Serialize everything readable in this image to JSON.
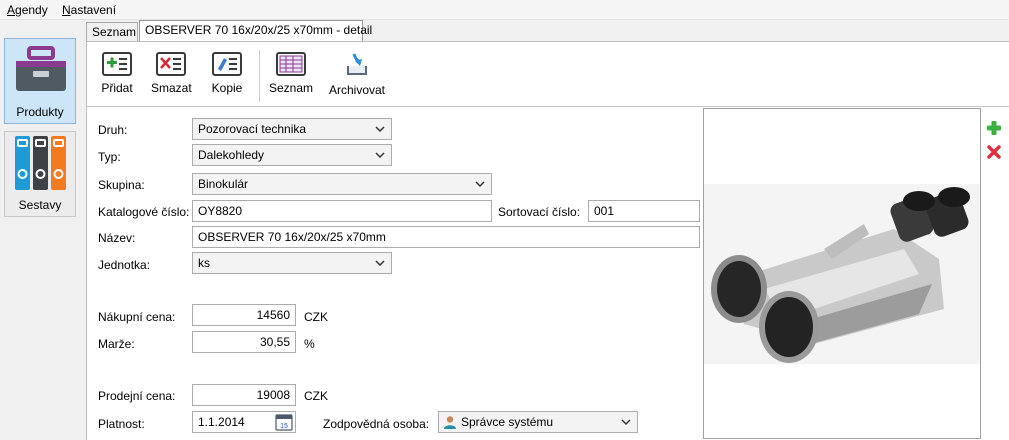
{
  "menu": [
    {
      "accel": "A",
      "rest": "gendy"
    },
    {
      "accel": "N",
      "rest": "astavení"
    }
  ],
  "nav": {
    "products_label": "Produkty",
    "sets_label": "Sestavy"
  },
  "tabs": {
    "list_label": "Seznam",
    "detail_label": "OBSERVER 70 16x/20x/25 x70mm - detail"
  },
  "toolbar": {
    "add_label": "Přidat",
    "delete_label": "Smazat",
    "copy_label": "Kopie",
    "list_label": "Seznam",
    "archive_label": "Archivovat"
  },
  "form": {
    "druh_label": "Druh:",
    "druh_value": "Pozorovací technika",
    "typ_label": "Typ:",
    "typ_value": "Dalekohledy",
    "skupina_label": "Skupina:",
    "skupina_value": "Binokulár",
    "katalog_label": "Katalogové číslo:",
    "katalog_value": "OY8820",
    "sort_label": "Sortovací číslo:",
    "sort_value": "001",
    "nazev_label": "Název:",
    "nazev_value": "OBSERVER 70 16x/20x/25 x70mm",
    "jednotka_label": "Jednotka:",
    "jednotka_value": "ks",
    "nakupni_label": "Nákupní cena:",
    "nakupni_value": "14560",
    "nakupni_unit": "CZK",
    "marze_label": "Marže:",
    "marze_value": "30,55",
    "marze_unit": "%",
    "prodejni_label": "Prodejní cena:",
    "prodejni_value": "19008",
    "prodejni_unit": "CZK",
    "platnost_label": "Platnost:",
    "platnost_value": "1.1.2014",
    "calendar_day": "15",
    "osoba_label": "Zodpovědná osoba:",
    "osoba_value": "Správce systému"
  },
  "colors": {
    "active_nav": "#cde6f7",
    "add_green": "#3cb043",
    "delete_red": "#e0303c",
    "products_icon": "#8b3a8f"
  }
}
